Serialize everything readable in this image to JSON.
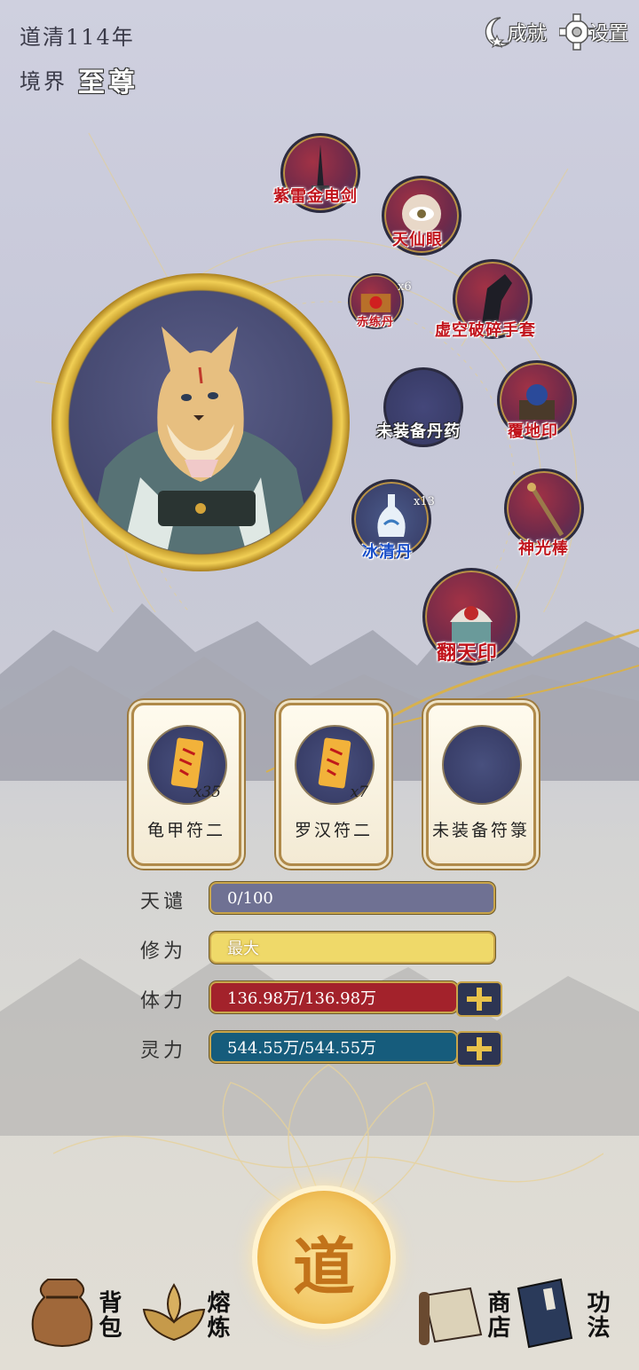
{
  "header": {
    "era": "道清114年",
    "realm_label": "境界",
    "realm_value": "至尊"
  },
  "top_buttons": {
    "achievements": "成就",
    "settings": "设置"
  },
  "equipment": [
    {
      "name": "紫雷金电剑",
      "count": ""
    },
    {
      "name": "天仙眼",
      "count": ""
    },
    {
      "name": "赤练丹",
      "count": "x6"
    },
    {
      "name": "虚空破碎手套",
      "count": ""
    },
    {
      "name": "未装备丹药",
      "count": ""
    },
    {
      "name": "覆地印",
      "count": ""
    },
    {
      "name": "冰清丹",
      "count": "x13"
    },
    {
      "name": "神光棒",
      "count": ""
    },
    {
      "name": "翻天印",
      "count": ""
    }
  ],
  "talismans": [
    {
      "name": "龟甲符二",
      "count": "x35"
    },
    {
      "name": "罗汉符二",
      "count": "x7"
    },
    {
      "name": "未装备符箓",
      "count": ""
    }
  ],
  "stats": {
    "tribulation": {
      "label": "天谴",
      "value": "0/100"
    },
    "cultivation": {
      "label": "修为",
      "value": "最大"
    },
    "stamina": {
      "label": "体力",
      "value": "136.98万/136.98万"
    },
    "spirit": {
      "label": "灵力",
      "value": "544.55万/544.55万"
    }
  },
  "bottom_nav": {
    "bag": "背包",
    "refine": "熔炼",
    "center": "道",
    "shop": "商店",
    "skills": "功法"
  },
  "colors": {
    "stamina_bar": "#a3222b",
    "spirit_bar": "#165c7c",
    "cultivation_bar": "#efd969",
    "tribulation_bar": "#6f7193",
    "accent_gold": "#c9a54a"
  }
}
